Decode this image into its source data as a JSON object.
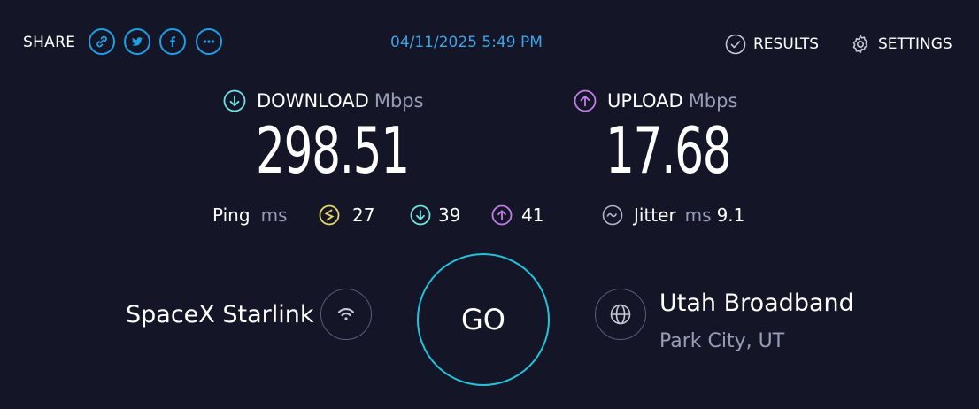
{
  "header": {
    "share_label": "SHARE",
    "datetime": "04/11/2025 5:49 PM",
    "results_label": "RESULTS",
    "settings_label": "SETTINGS"
  },
  "download": {
    "label": "DOWNLOAD",
    "unit": "Mbps",
    "value": "298.51",
    "color": "#6ee4e6"
  },
  "upload": {
    "label": "UPLOAD",
    "unit": "Mbps",
    "value": "17.68",
    "color": "#c17ee8"
  },
  "ping": {
    "label": "Ping",
    "unit": "ms",
    "idle": "27",
    "idle_color": "#e8d86a",
    "download": "39",
    "upload": "41"
  },
  "jitter": {
    "label": "Jitter",
    "unit": "ms",
    "value": "9.1"
  },
  "isp": {
    "name": "SpaceX Starlink"
  },
  "go_label": "GO",
  "server": {
    "name": "Utah Broadband",
    "location": "Park City, UT"
  },
  "colors": {
    "background": "#141526",
    "accent_blue": "#1ea0e6",
    "go_ring": "#22c4dc"
  }
}
